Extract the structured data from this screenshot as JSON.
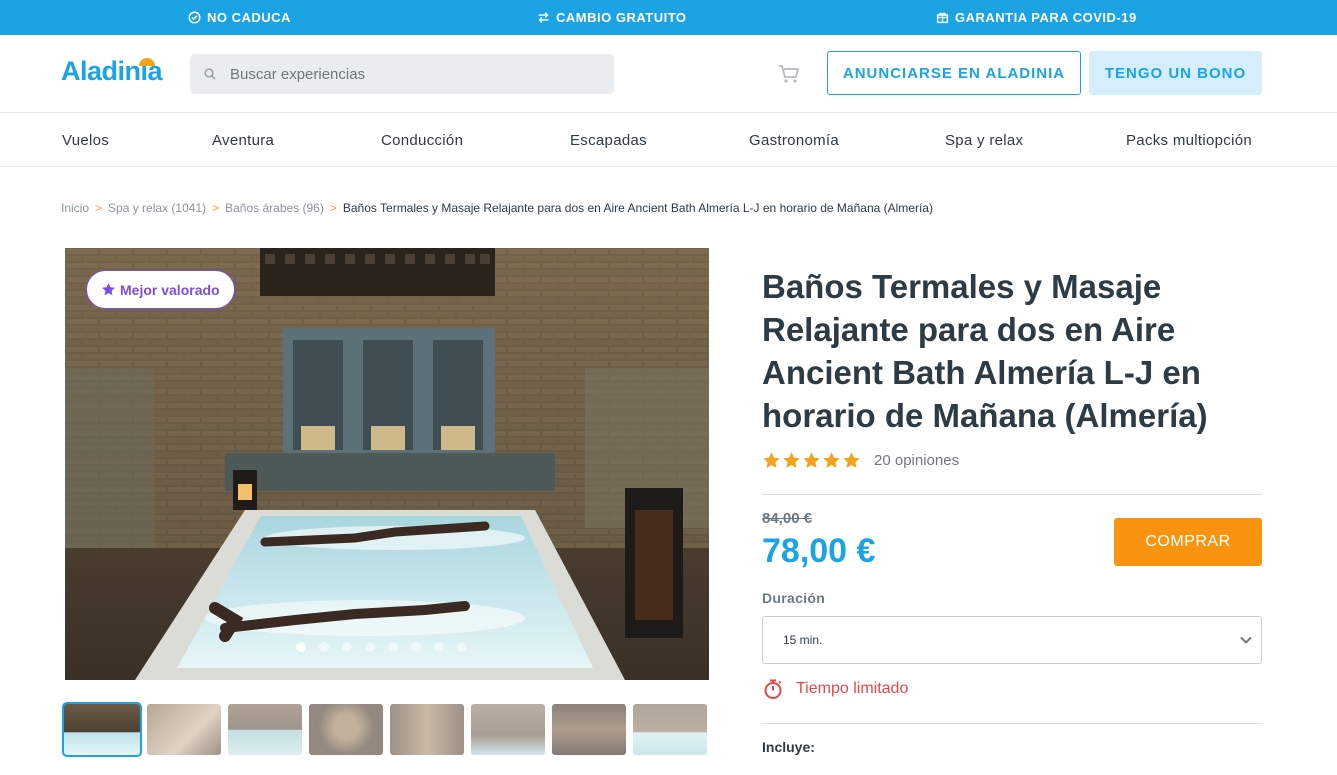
{
  "topbar": {
    "perks": [
      {
        "icon": "clock-check-icon",
        "label": "NO CADUCA"
      },
      {
        "icon": "swap-arrows-icon",
        "label": "CAMBIO GRATUITO"
      },
      {
        "icon": "gift-box-icon",
        "label": "GARANTIA PARA COVID-19"
      }
    ],
    "color": "#1ba3e3"
  },
  "header": {
    "logo": "Aladinia",
    "search_placeholder": "Buscar experiencias",
    "announce_label": "ANUNCIARSE EN ALADINIA",
    "bono_label": "TENGO UN BONO"
  },
  "nav": {
    "items": [
      "Vuelos",
      "Aventura",
      "Conducción",
      "Escapadas",
      "Gastronomía",
      "Spa y relax",
      "Packs multiopción"
    ]
  },
  "breadcrumb": {
    "items": [
      {
        "label": "Inicio",
        "count": ""
      },
      {
        "label": "Spa y relax",
        "count": "(1041)"
      },
      {
        "label": "Baños árabes",
        "count": "(96)"
      }
    ],
    "current": "Baños Termales y Masaje Relajante para dos en Aire Ancient Bath Almería L-J en horario de Mañana (Almería)"
  },
  "gallery": {
    "badge": "Mejor valorado",
    "slides": 8,
    "active_slide": 1,
    "thumb_count": 8
  },
  "product": {
    "title": "Baños Termales y Masaje Relajante para dos en Aire Ancient Bath Almería L-J en horario de Mañana (Almería)",
    "rating": 5,
    "reviews": "20 opiniones",
    "old_price": "84,00 €",
    "price": "78,00 €",
    "buy_label": "COMPRAR",
    "duration_label": "Duración",
    "duration_value": "15 min.",
    "limited_label": "Tiempo limitado",
    "includes_label": "Incluye:"
  },
  "colors": {
    "accent": "#1ba3e3",
    "buy": "#f89410",
    "badge": "#7b4de0",
    "star": "#f7a21b",
    "limited": "#e8474b"
  }
}
